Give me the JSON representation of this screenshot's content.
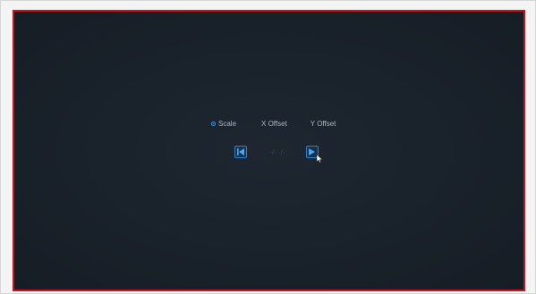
{
  "offset_panel": {
    "options": {
      "scale_label": "Scale",
      "x_offset_label": "X Offset",
      "y_offset_label": "Y Offset",
      "selected": "Scale"
    },
    "value_display": "·/·  ·/·"
  },
  "colors": {
    "frame_border": "#c8141c",
    "accent": "#3d9ce8",
    "screen_bg": "#1b232c"
  },
  "icons": {
    "previous": "left-arrow-icon",
    "next": "right-arrow-icon",
    "pointer": "mouse-pointer-icon"
  }
}
